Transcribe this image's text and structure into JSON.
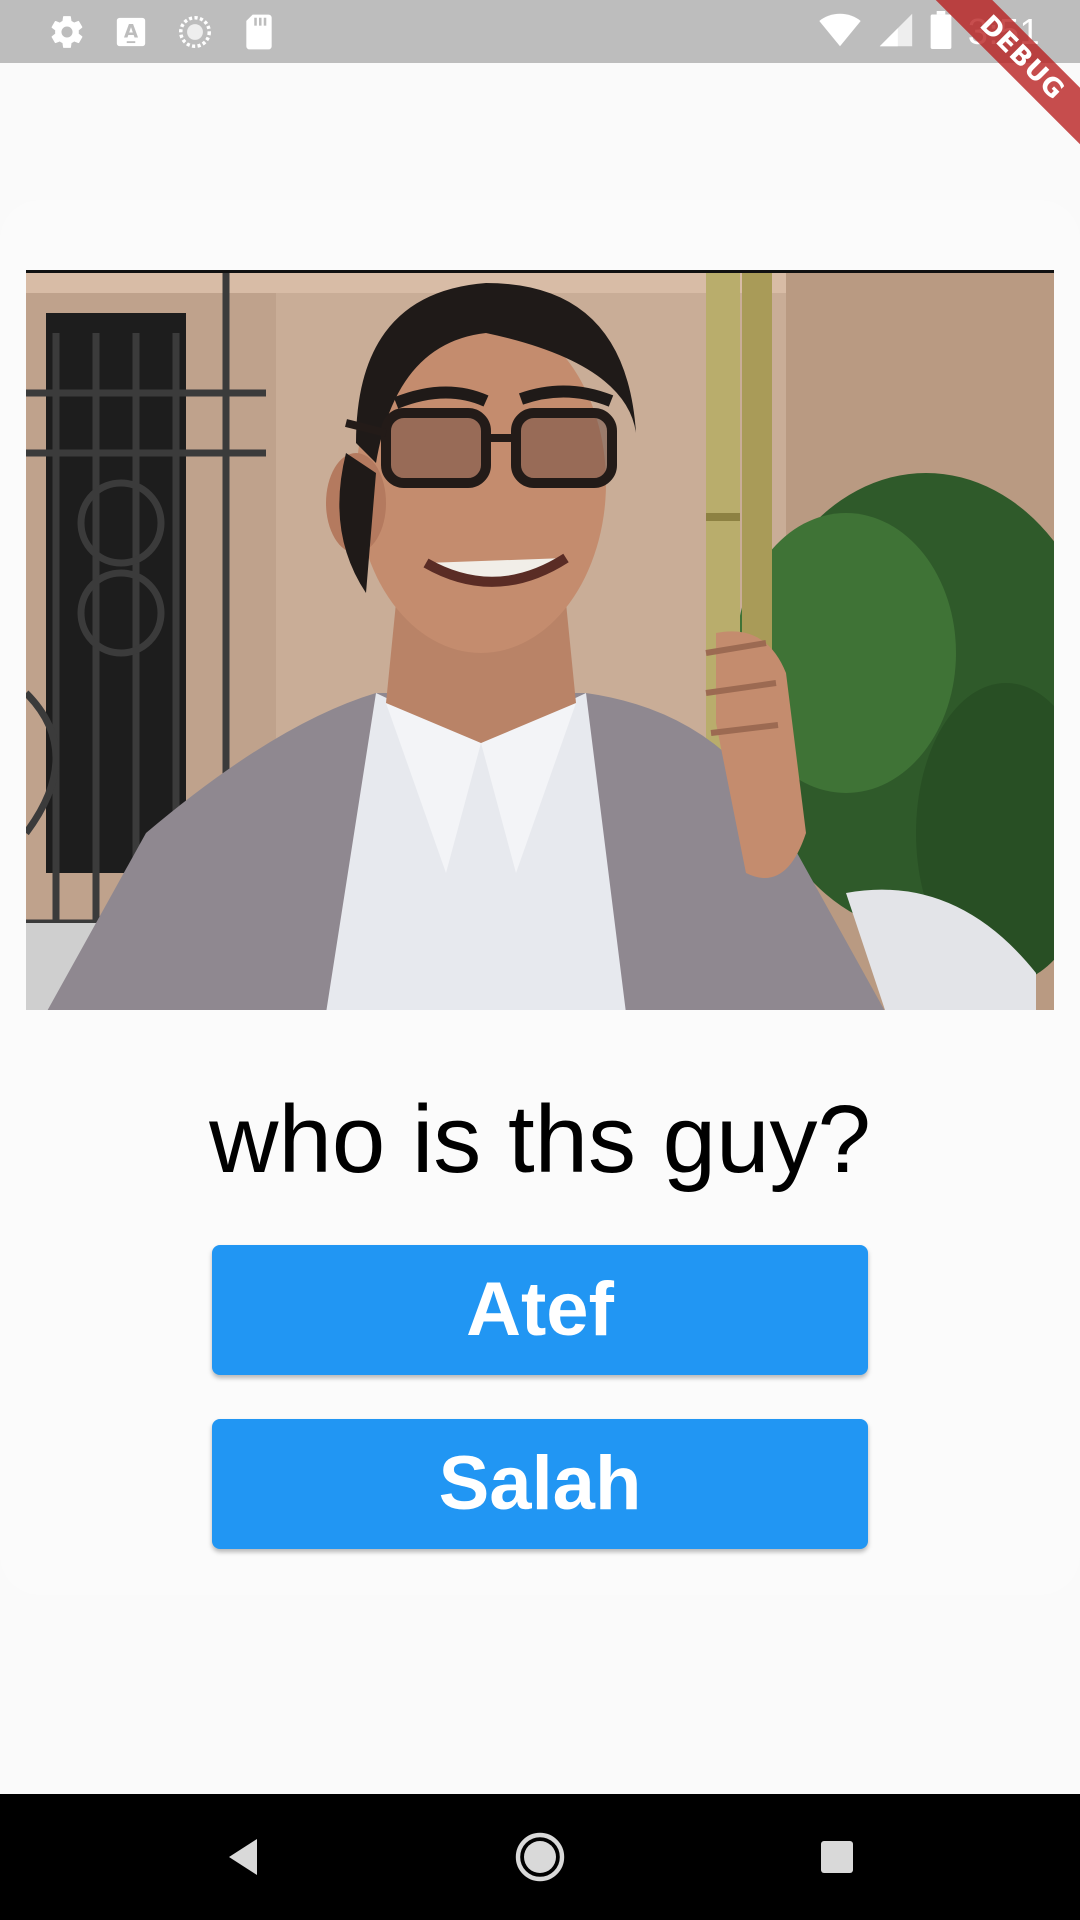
{
  "status_bar": {
    "time": "3:51",
    "left_icons": [
      "settings-icon",
      "a-text-icon",
      "sync-icon",
      "sd-card-icon"
    ],
    "right_icons": [
      "wifi-icon",
      "signal-icon",
      "battery-icon"
    ]
  },
  "debug_banner": {
    "label": "DEBUG",
    "color": "#b71c1c"
  },
  "quiz": {
    "image_alt": "",
    "question": "who is ths guy?",
    "answers": [
      "Atef",
      "Salah"
    ],
    "button_color": "#2196f3"
  },
  "nav_bar": {
    "buttons": [
      "back-icon",
      "home-icon",
      "recents-icon"
    ]
  }
}
